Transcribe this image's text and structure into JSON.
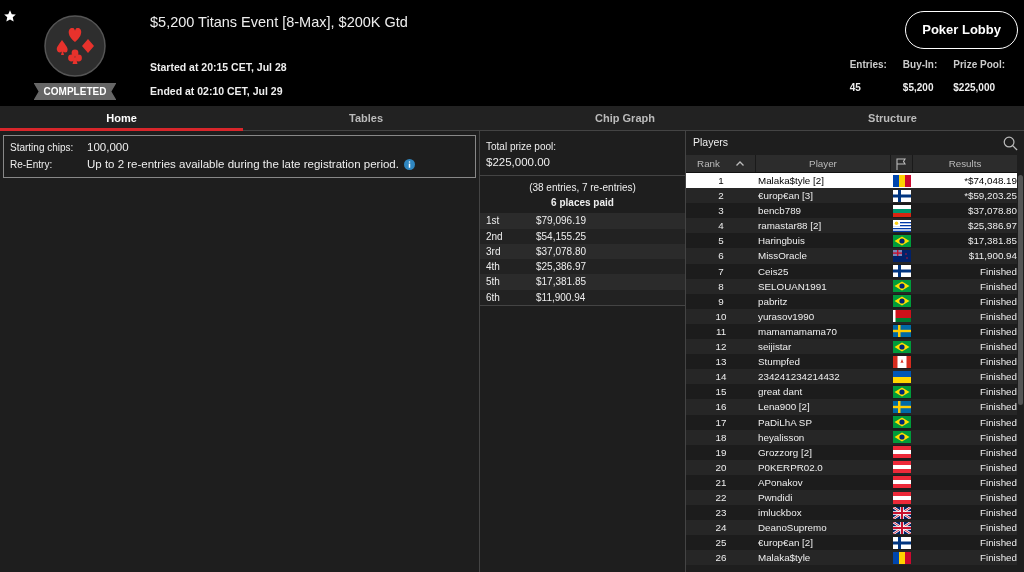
{
  "header": {
    "title": "$5,200 Titans Event [8-Max], $200K Gtd",
    "status": "COMPLETED",
    "started": "Started at 20:15 CET, Jul 28",
    "ended": "Ended at 02:10 CET, Jul 29",
    "lobby_button": "Poker Lobby",
    "stats": [
      {
        "label": "Entries:",
        "value": "45"
      },
      {
        "label": "Buy-In:",
        "value": "$5,200"
      },
      {
        "label": "Prize Pool:",
        "value": "$225,000"
      }
    ]
  },
  "tabs": [
    {
      "label": "Home",
      "selected": true
    },
    {
      "label": "Tables",
      "selected": false
    },
    {
      "label": "Chip Graph",
      "selected": false
    },
    {
      "label": "Structure",
      "selected": false
    }
  ],
  "info": [
    {
      "label": "Starting chips:",
      "value": "100,000"
    },
    {
      "label": "Re-Entry:",
      "value": "Up to 2 re-entries available during the late registration period."
    }
  ],
  "prizes": {
    "total_label": "Total prize pool:",
    "total": "$225,000.00",
    "entries_note": "(38 entries, 7 re-entries)",
    "places_paid": "6 places paid",
    "rows": [
      {
        "place": "1st",
        "amount": "$79,096.19"
      },
      {
        "place": "2nd",
        "amount": "$54,155.25"
      },
      {
        "place": "3rd",
        "amount": "$37,078.80"
      },
      {
        "place": "4th",
        "amount": "$25,386.97"
      },
      {
        "place": "5th",
        "amount": "$17,381.85"
      },
      {
        "place": "6th",
        "amount": "$11,900.94"
      }
    ]
  },
  "players": {
    "title": "Players",
    "columns": [
      "Rank",
      "Player",
      "Results"
    ],
    "rows": [
      {
        "rank": "1",
        "player": "Malaka$tyle [2]",
        "kind": "md",
        "result": "*$74,048.19",
        "selected": true
      },
      {
        "rank": "2",
        "player": "€urop€an [3]",
        "kind": "fi",
        "result": "*$59,203.25",
        "selected": false
      },
      {
        "rank": "3",
        "player": "bencb789",
        "kind": "bg",
        "result": "$37,078.80",
        "selected": false
      },
      {
        "rank": "4",
        "player": "ramastar88 [2]",
        "kind": "uy",
        "result": "$25,386.97",
        "selected": false
      },
      {
        "rank": "5",
        "player": "Haringbuis",
        "kind": "br",
        "result": "$17,381.85",
        "selected": false
      },
      {
        "rank": "6",
        "player": "MissOracle",
        "kind": "nz",
        "result": "$11,900.94",
        "selected": false
      },
      {
        "rank": "7",
        "player": "Ceis25",
        "kind": "fi",
        "result": "Finished",
        "selected": false
      },
      {
        "rank": "8",
        "player": "SELOUAN1991",
        "kind": "br",
        "result": "Finished",
        "selected": false
      },
      {
        "rank": "9",
        "player": "pabritz",
        "kind": "br",
        "result": "Finished",
        "selected": false
      },
      {
        "rank": "10",
        "player": "yurasov1990",
        "kind": "by",
        "result": "Finished",
        "selected": false
      },
      {
        "rank": "11",
        "player": "mamamamama70",
        "kind": "se",
        "result": "Finished",
        "selected": false
      },
      {
        "rank": "12",
        "player": "seijistar",
        "kind": "br",
        "result": "Finished",
        "selected": false
      },
      {
        "rank": "13",
        "player": "Stumpfed",
        "kind": "ca",
        "result": "Finished",
        "selected": false
      },
      {
        "rank": "14",
        "player": "234241234214432",
        "kind": "ua",
        "result": "Finished",
        "selected": false
      },
      {
        "rank": "15",
        "player": "great dant",
        "kind": "br",
        "result": "Finished",
        "selected": false
      },
      {
        "rank": "16",
        "player": "Lena900 [2]",
        "kind": "se",
        "result": "Finished",
        "selected": false
      },
      {
        "rank": "17",
        "player": "PaDiLhA SP",
        "kind": "br",
        "result": "Finished",
        "selected": false
      },
      {
        "rank": "18",
        "player": "heyalisson",
        "kind": "br",
        "result": "Finished",
        "selected": false
      },
      {
        "rank": "19",
        "player": "Grozzorg [2]",
        "kind": "at",
        "result": "Finished",
        "selected": false
      },
      {
        "rank": "20",
        "player": "P0KERPR02.0",
        "kind": "at",
        "result": "Finished",
        "selected": false
      },
      {
        "rank": "21",
        "player": "APonakov",
        "kind": "at",
        "result": "Finished",
        "selected": false
      },
      {
        "rank": "22",
        "player": "Pwndidi",
        "kind": "at",
        "result": "Finished",
        "selected": false
      },
      {
        "rank": "23",
        "player": "imluckbox",
        "kind": "gb",
        "result": "Finished",
        "selected": false
      },
      {
        "rank": "24",
        "player": "DeanoSupremo",
        "kind": "gb",
        "result": "Finished",
        "selected": false
      },
      {
        "rank": "25",
        "player": "€urop€an [2]",
        "kind": "fi",
        "result": "Finished",
        "selected": false
      },
      {
        "rank": "26",
        "player": "Malaka$tyle",
        "kind": "md",
        "result": "Finished",
        "selected": false
      }
    ]
  }
}
